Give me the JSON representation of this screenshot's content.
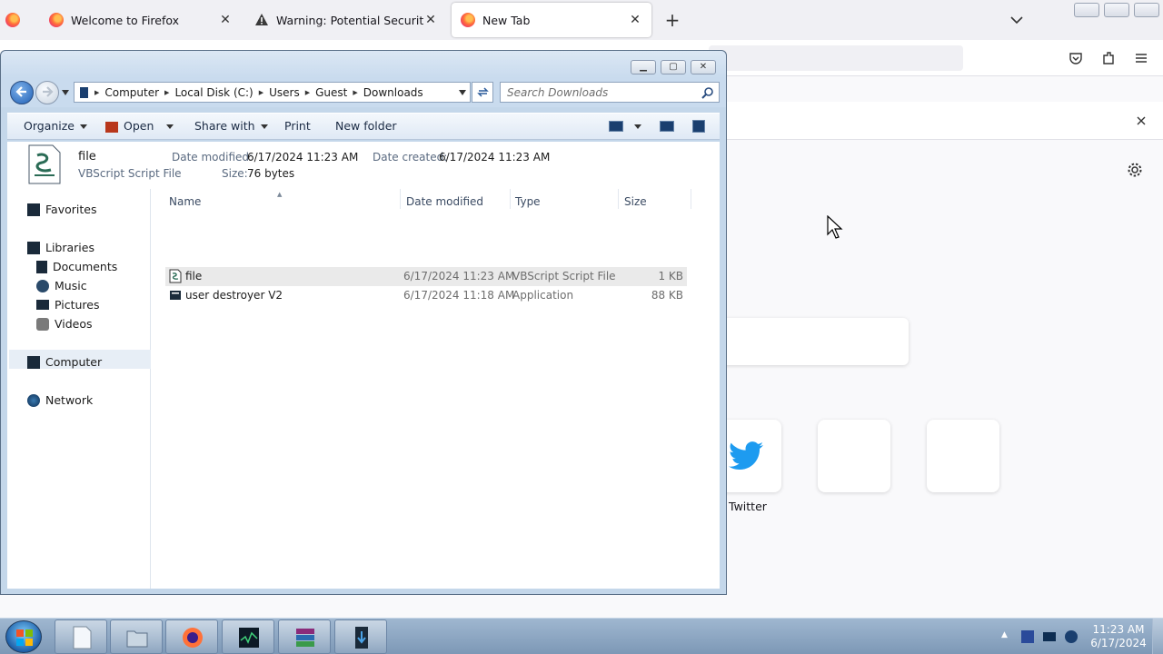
{
  "firefox": {
    "tabs": [
      {
        "label": "Welcome to Firefox",
        "icon": "firefox-icon"
      },
      {
        "label": "Warning: Potential Security Risk",
        "icon": "warning-icon"
      },
      {
        "label": "New Tab",
        "icon": "firefox-icon"
      }
    ],
    "new_tab_symbol": "+",
    "shortcut_label": "Twitter",
    "colors": {
      "twitter": "#1d9bf0",
      "background": "#f9f9fb"
    }
  },
  "explorer": {
    "breadcrumb": [
      "Computer",
      "Local Disk (C:)",
      "Users",
      "Guest",
      "Downloads"
    ],
    "search_placeholder": "Search Downloads",
    "toolbar": {
      "organize": "Organize",
      "open": "Open",
      "share_with": "Share with",
      "print": "Print",
      "new_folder": "New folder"
    },
    "details": {
      "name": "file",
      "type": "VBScript Script File",
      "date_modified_label": "Date modified:",
      "date_modified": "6/17/2024 11:23 AM",
      "date_created_label": "Date created:",
      "date_created": "6/17/2024 11:23 AM",
      "size_label": "Size:",
      "size": "76 bytes"
    },
    "nav": {
      "favorites": "Favorites",
      "libraries": "Libraries",
      "documents": "Documents",
      "music": "Music",
      "pictures": "Pictures",
      "videos": "Videos",
      "computer": "Computer",
      "network": "Network"
    },
    "columns": {
      "name": "Name",
      "date_modified": "Date modified",
      "type": "Type",
      "size": "Size"
    },
    "files": [
      {
        "name": "file",
        "date_modified": "6/17/2024 11:23 AM",
        "type": "VBScript Script File",
        "size": "1 KB",
        "icon": "vbscript-file-icon"
      },
      {
        "name": "user destroyer V2",
        "date_modified": "6/17/2024 11:18 AM",
        "type": "Application",
        "size": "88 KB",
        "icon": "application-icon"
      }
    ]
  },
  "taskbar": {
    "apps": [
      "file-explorer-icon",
      "explorer-folder-icon",
      "firefox-icon",
      "task-manager-icon",
      "winrar-icon",
      "downloads-app-icon"
    ],
    "clock": {
      "time": "11:23 AM",
      "date": "6/17/2024"
    }
  }
}
